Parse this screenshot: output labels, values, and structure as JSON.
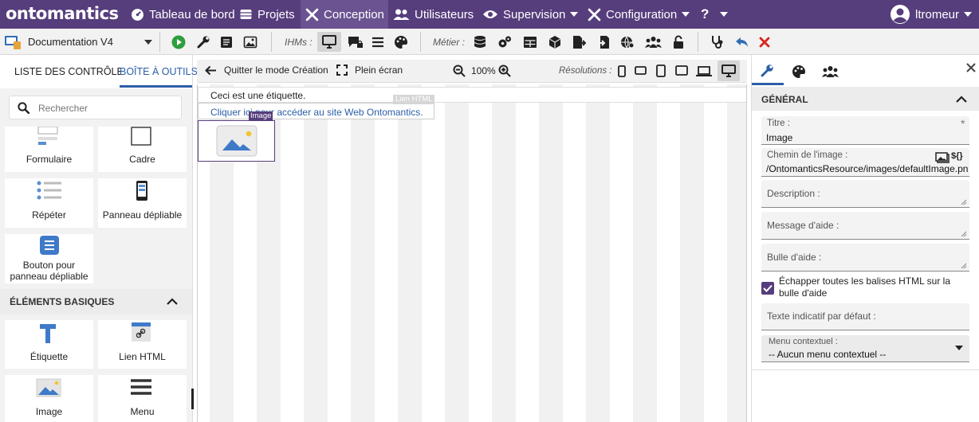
{
  "app": {
    "logo": "ontomantics"
  },
  "nav": {
    "items": [
      {
        "label": "Tableau de bord",
        "icon": "dashboard-icon"
      },
      {
        "label": "Projets",
        "icon": "database-icon"
      },
      {
        "label": "Conception",
        "icon": "tools-icon",
        "active": true
      },
      {
        "label": "Utilisateurs",
        "icon": "users-icon"
      },
      {
        "label": "Supervision",
        "icon": "eye-icon"
      },
      {
        "label": "Configuration",
        "icon": "wrench-icon"
      },
      {
        "label": "?",
        "icon": "help-icon"
      }
    ],
    "user": "ltromeur"
  },
  "toolbar": {
    "project": "Documentation V4",
    "ihms_label": "IHMs :",
    "metier_label": "Métier :"
  },
  "left": {
    "tabs": [
      "LISTE DES CONTRÔLE",
      "BOÎTE À OUTILS"
    ],
    "active_tab": 1,
    "search_placeholder": "Rechercher",
    "tiles_top": [
      "Formulaire",
      "Cadre",
      "Répéter",
      "Panneau dépliable",
      "Bouton pour panneau dépliable"
    ],
    "section_title": "ÉLÉMENTS BASIQUES",
    "tiles_basic": [
      "Étiquette",
      "Lien HTML",
      "Image",
      "Menu"
    ]
  },
  "canvas_bar": {
    "quit": "Quitter le mode Création",
    "fullscreen": "Plein écran",
    "zoom": "100%",
    "resolutions": "Résolutions :"
  },
  "canvas": {
    "label_text": "Ceci est une étiquette.",
    "link_text": "Cliquer ici pour accéder au site Web Ontomantics.",
    "link_tag": "Lien HTML",
    "image_tag": "Image"
  },
  "right": {
    "section": "GÉNÉRAL",
    "title_label": "Titre :",
    "title_value": "Image",
    "path_label": "Chemin de l'image :",
    "path_value": "/OntomanticsResource/images/defaultImage.png",
    "description_label": "Description :",
    "help_message_label": "Message d'aide :",
    "help_bubble_label": "Bulle d'aide :",
    "escape_label": "Échapper toutes les balises HTML sur la bulle d'aide",
    "escape_checked": true,
    "placeholder_label": "Texte indicatif par défaut :",
    "context_menu_label": "Menu contextuel :",
    "context_menu_value": "-- Aucun menu contextuel --",
    "var_button": "${}"
  },
  "colors": {
    "brand": "#563d7c",
    "link": "#2b5ea7",
    "accent_blue": "#2f6db5",
    "delete_red": "#d9251d",
    "run_green": "#2e9e3e"
  }
}
